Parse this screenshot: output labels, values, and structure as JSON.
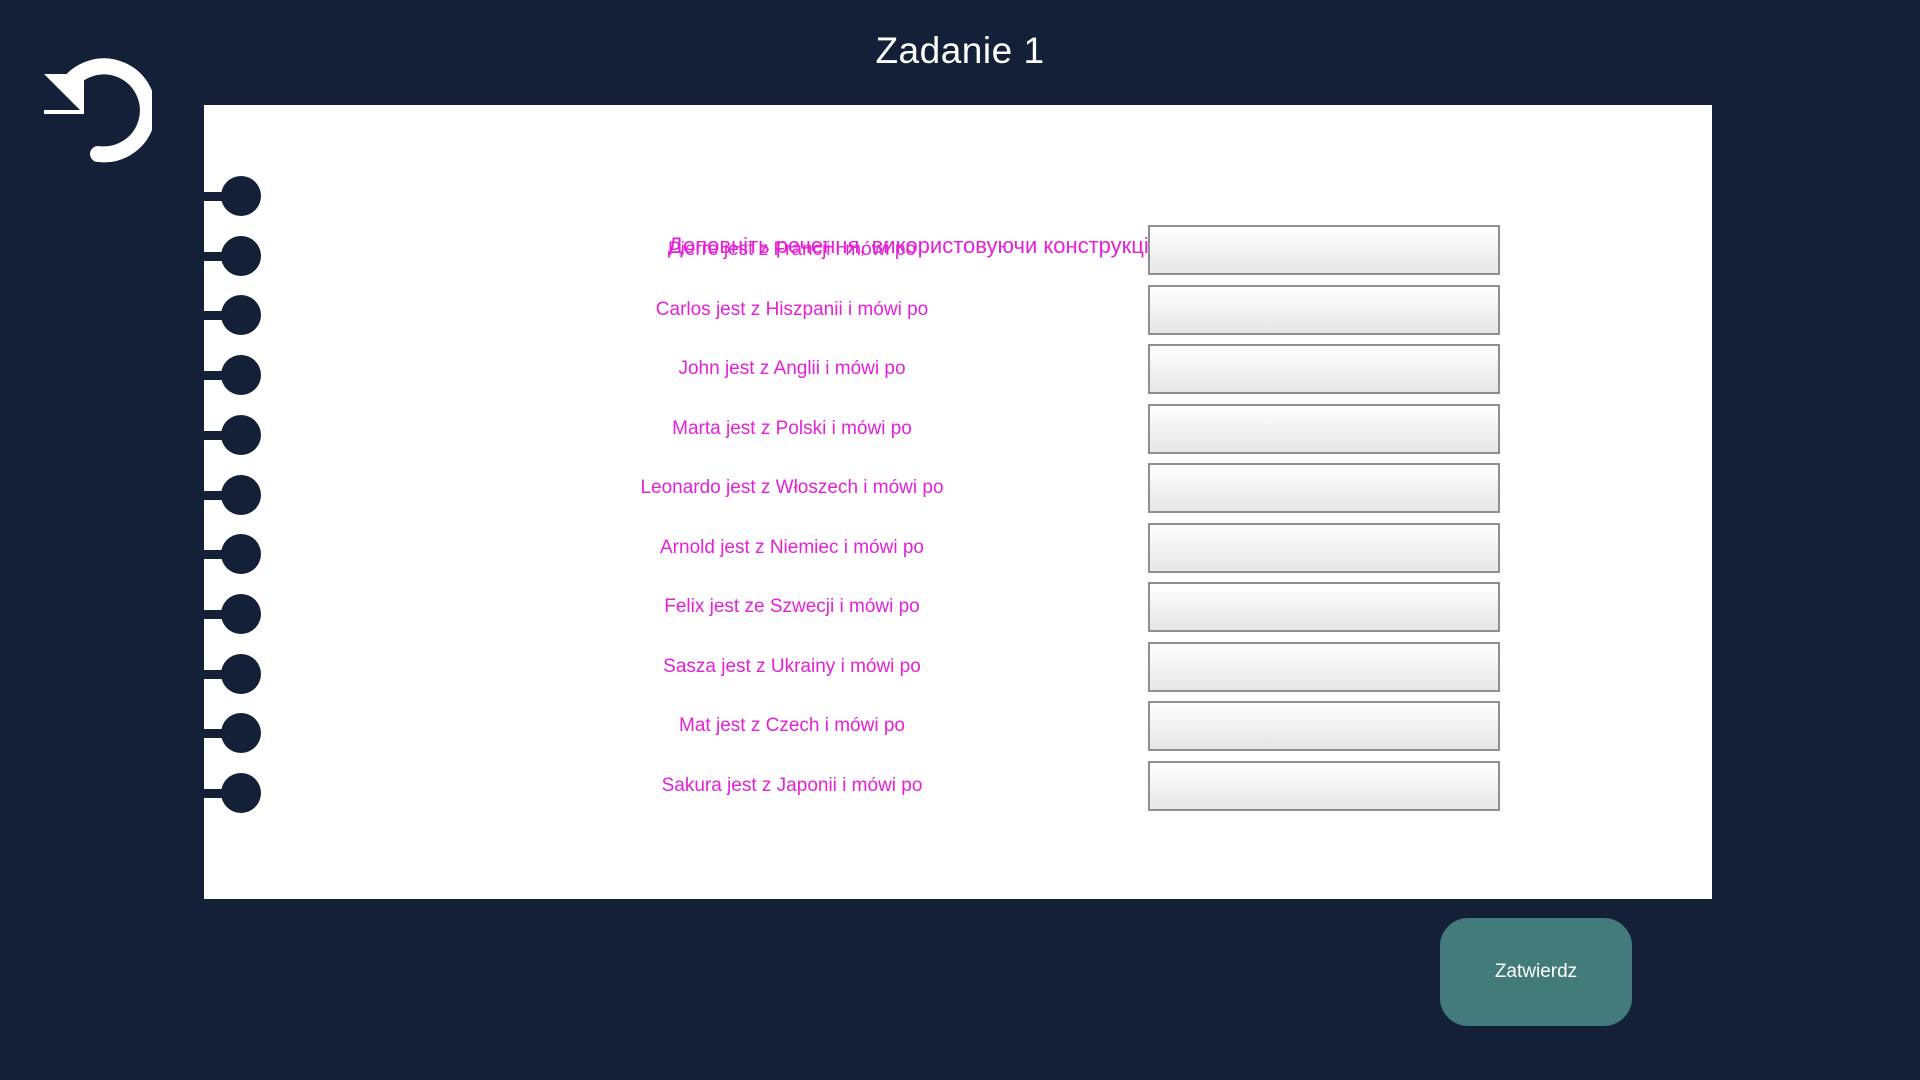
{
  "header": {
    "title": "Zadanie 1",
    "back_icon": "undo-arrow-icon"
  },
  "exercise": {
    "instruction": "Доповніть речення, використовуючи конструкцію \"po u...\"",
    "items": [
      {
        "prompt": "Pierre jest z Francji i mówi po",
        "answer": ""
      },
      {
        "prompt": "Carlos jest z Hiszpanii i mówi po",
        "answer": ""
      },
      {
        "prompt": "John jest z Anglii i mówi po",
        "answer": ""
      },
      {
        "prompt": "Marta jest z Polski i mówi po",
        "answer": ""
      },
      {
        "prompt": "Leonardo jest z Włoszech i mówi po",
        "answer": ""
      },
      {
        "prompt": "Arnold jest z Niemiec i mówi po",
        "answer": ""
      },
      {
        "prompt": "Felix jest ze Szwecji i mówi po",
        "answer": ""
      },
      {
        "prompt": "Sasza jest z Ukrainy i mówi po",
        "answer": ""
      },
      {
        "prompt": "Mat jest z Czech i mówi po",
        "answer": ""
      },
      {
        "prompt": "Sakura jest z Japonii i mówi po",
        "answer": ""
      }
    ]
  },
  "footer": {
    "submit_label": "Zatwierdz"
  },
  "colors": {
    "background": "#132038",
    "accent_text": "#e620d8",
    "submit_button": "#437b7a",
    "page": "#ffffff"
  }
}
